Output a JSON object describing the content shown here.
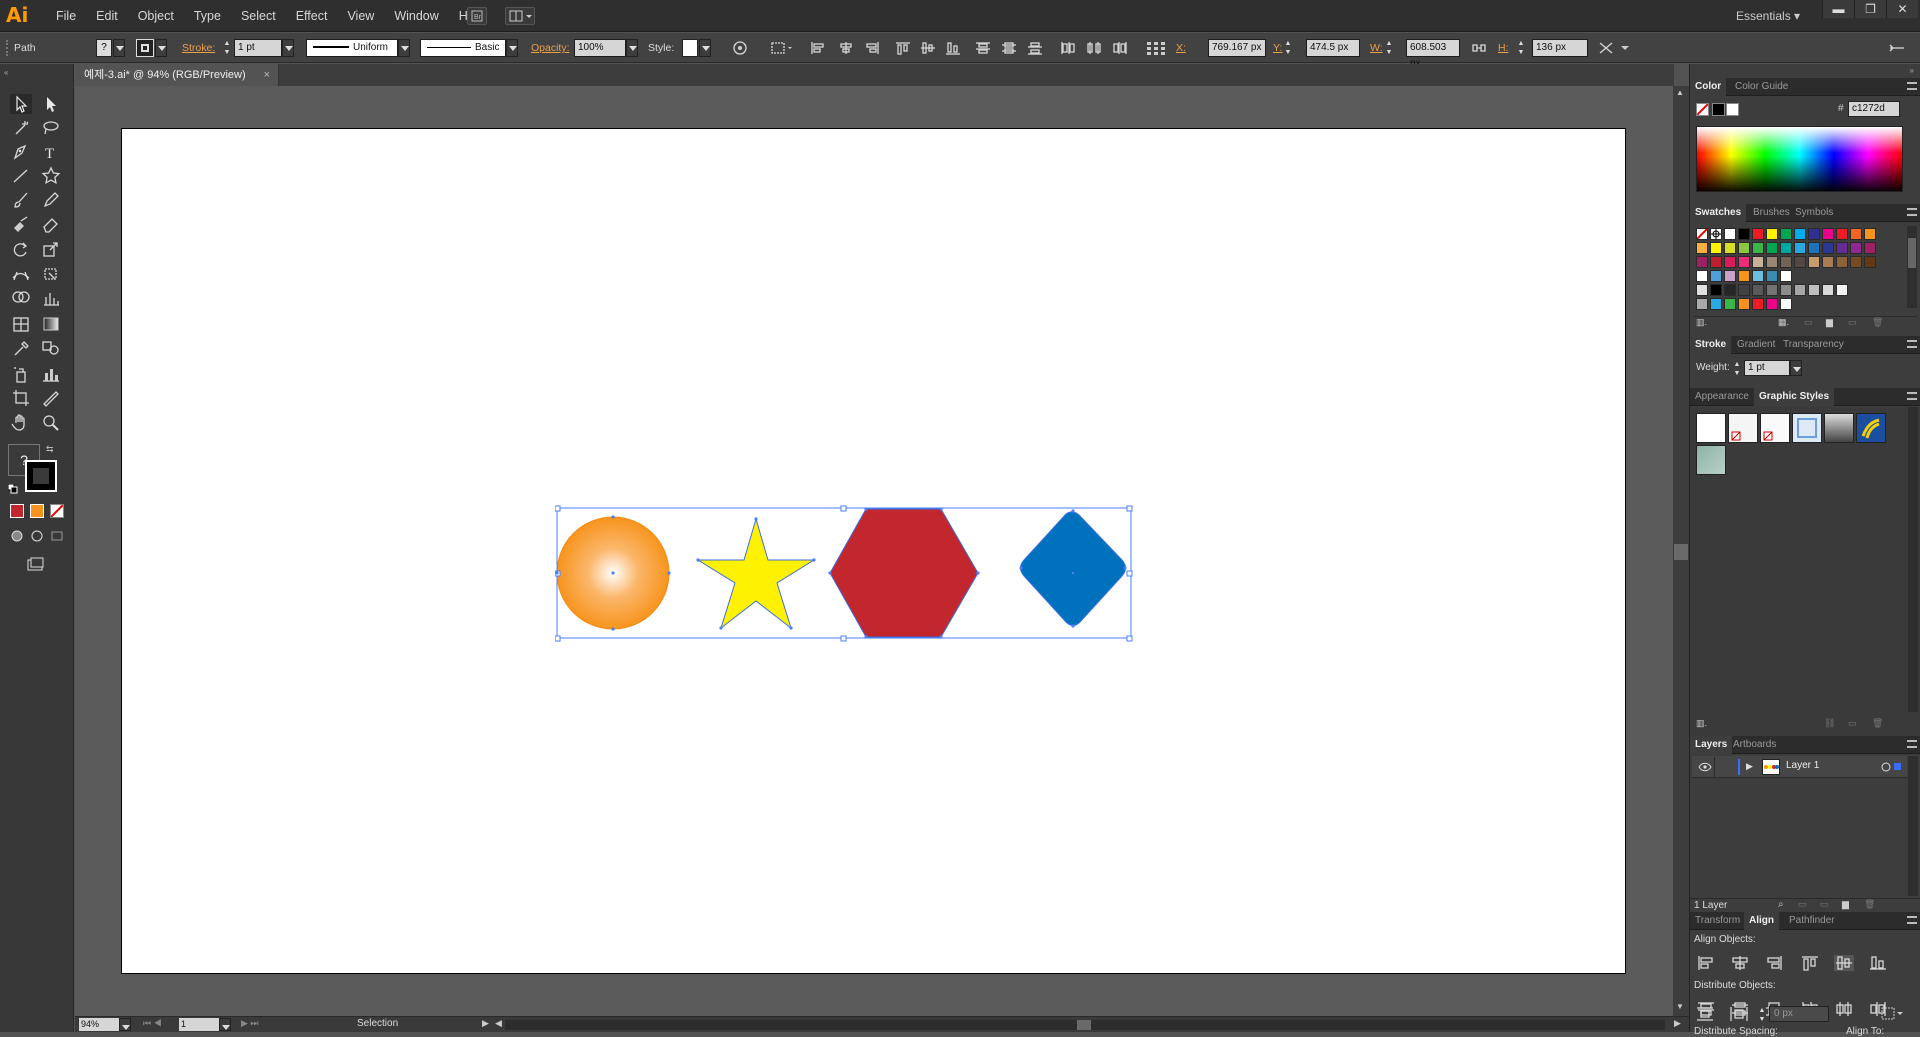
{
  "app": {
    "logo": "Ai",
    "workspace": "Essentials"
  },
  "menu": [
    "File",
    "Edit",
    "Object",
    "Type",
    "Select",
    "Effect",
    "View",
    "Window",
    "Help"
  ],
  "control": {
    "selection_type": "Path",
    "stroke_label": "Stroke:",
    "stroke_weight": "1 pt",
    "profile": "Uniform",
    "brush": "Basic",
    "opacity_label": "Opacity:",
    "opacity": "100%",
    "style_label": "Style:",
    "x_label": "X:",
    "x": "769.167 px",
    "y_label": "Y:",
    "y": "474.5 px",
    "w_label": "W:",
    "w": "608.503 px",
    "h_label": "H:",
    "h": "136 px"
  },
  "document": {
    "tab_title": "예제-3.ai* @ 94% (RGB/Preview)",
    "close": "×"
  },
  "toolbox": {
    "fill_stroke_unknown": "?"
  },
  "artwork": {
    "shapes": [
      {
        "name": "circle",
        "fill": "#f7941d",
        "gradient": "radial"
      },
      {
        "name": "star",
        "fill": "#fff200"
      },
      {
        "name": "hexagon",
        "fill": "#c1272d"
      },
      {
        "name": "rounded-diamond",
        "fill": "#0071bc"
      }
    ],
    "selection_color": "#4a7fff"
  },
  "status": {
    "zoom": "94%",
    "artboard": "1",
    "tool": "Selection"
  },
  "panels": {
    "color": {
      "tabs": [
        "Color",
        "Color Guide"
      ],
      "hex_label": "#",
      "hex": "c1272d"
    },
    "swatches": {
      "tabs": [
        "Swatches",
        "Brushes",
        "Symbols"
      ]
    },
    "stroke": {
      "tabs": [
        "Stroke",
        "Gradient",
        "Transparency"
      ],
      "weight_label": "Weight:",
      "weight": "1 pt"
    },
    "graphic_styles": {
      "tabs": [
        "Appearance",
        "Graphic Styles"
      ]
    },
    "layers": {
      "tabs": [
        "Layers",
        "Artboards"
      ],
      "layer_name": "Layer 1",
      "count": "1 Layer"
    },
    "align": {
      "tabs": [
        "Transform",
        "Align",
        "Pathfinder"
      ],
      "align_objects": "Align Objects:",
      "distribute_objects": "Distribute Objects:",
      "distribute_spacing": "Distribute Spacing:",
      "align_to": "Align To:",
      "spacing": "0 px"
    }
  }
}
